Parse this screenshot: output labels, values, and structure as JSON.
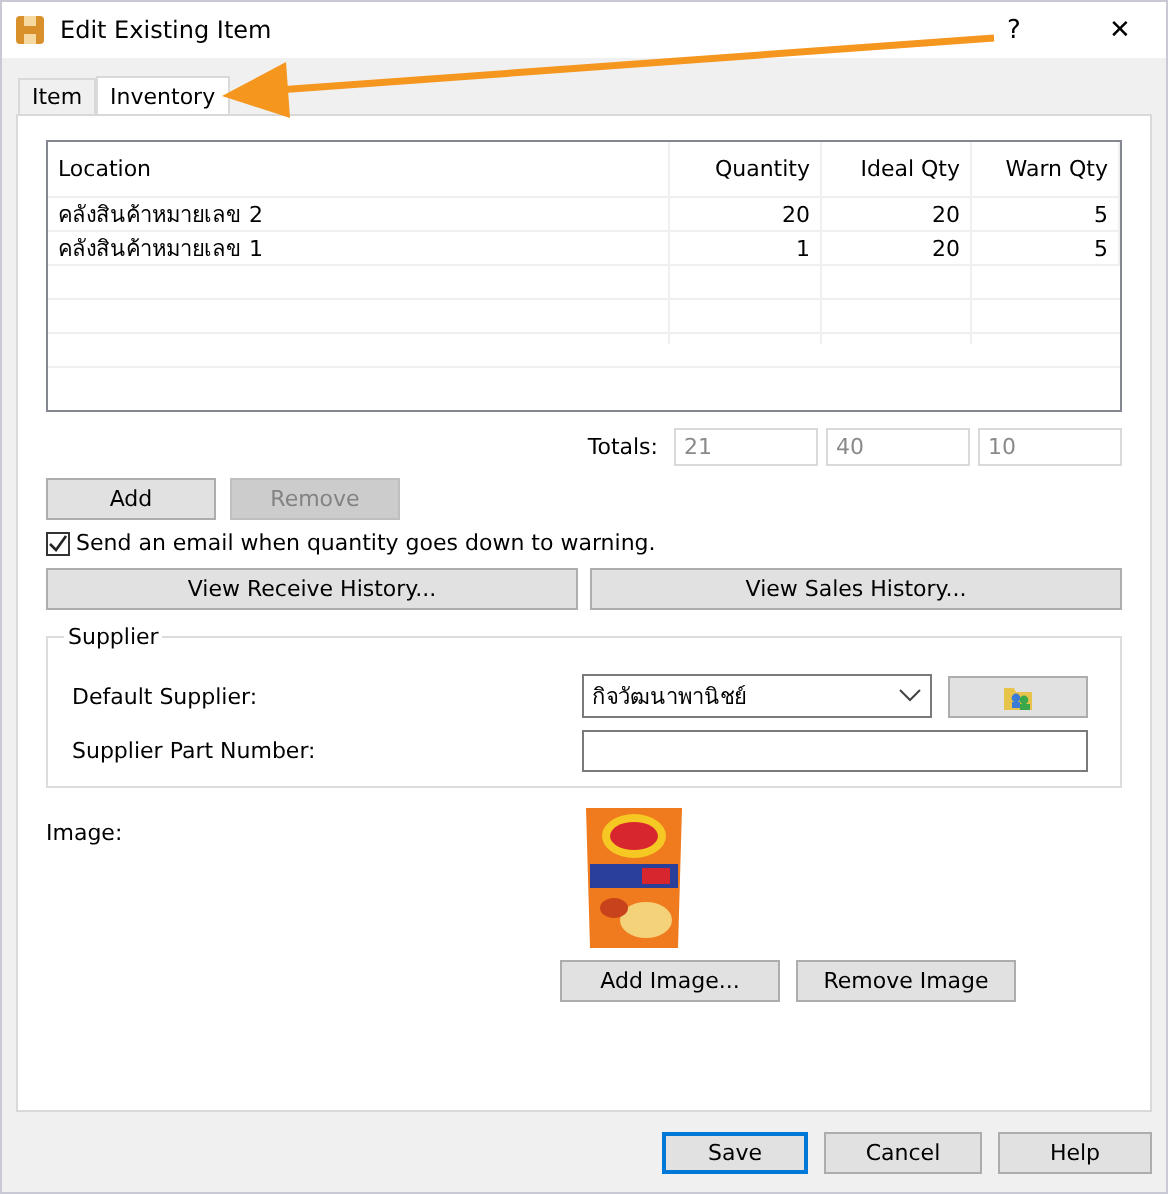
{
  "window": {
    "title": "Edit Existing Item",
    "help": "?",
    "close": "✕"
  },
  "tabs": [
    {
      "label": "Item",
      "selected": false
    },
    {
      "label": "Inventory",
      "selected": true
    }
  ],
  "table": {
    "columns": [
      "Location",
      "Quantity",
      "Ideal Qty",
      "Warn Qty"
    ],
    "rows": [
      [
        "คลังสินค้าหมายเลข 2",
        "20",
        "20",
        "5"
      ],
      [
        "คลังสินค้าหมายเลข 1",
        "1",
        "20",
        "5"
      ]
    ]
  },
  "totals": {
    "label": "Totals:",
    "values": [
      "21",
      "40",
      "10"
    ]
  },
  "row_buttons": [
    {
      "label": "Add",
      "disabled": false
    },
    {
      "label": "Remove",
      "disabled": true
    }
  ],
  "email_warning": {
    "label": "Send an email when quantity goes down to warning.",
    "checked": true
  },
  "history_buttons": [
    "View Receive History...",
    "View Sales History..."
  ],
  "supplier": {
    "title": "Supplier",
    "default_label": "Default Supplier:",
    "default_value": "กิจวัฒนาพานิชย์",
    "part_label": "Supplier Part Number:"
  },
  "image": {
    "label": "Image:",
    "kind": "picture",
    "buttons": [
      "Add Image...",
      "Remove Image"
    ]
  },
  "footer_buttons": [
    {
      "label": "Save",
      "default": true
    },
    {
      "label": "Cancel",
      "default": false
    },
    {
      "label": "Help",
      "default": false
    }
  ]
}
